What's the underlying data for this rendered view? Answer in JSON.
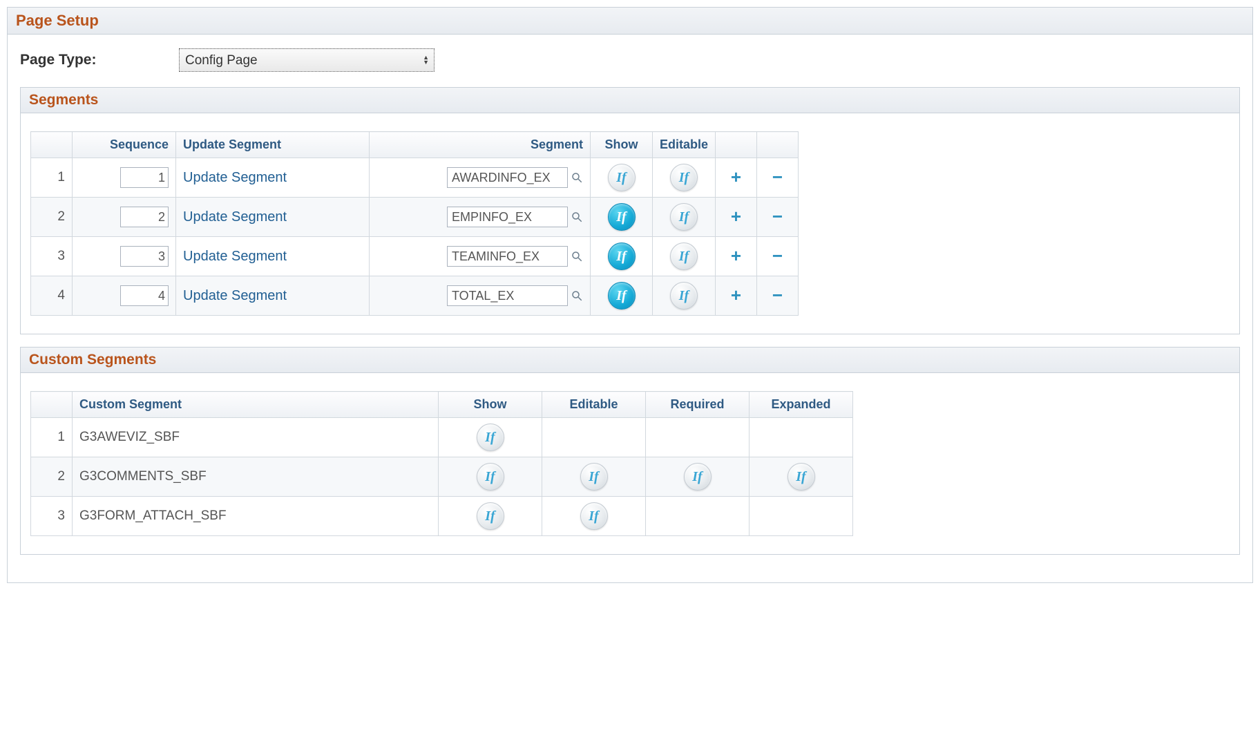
{
  "pageSetup": {
    "title": "Page Setup",
    "pageTypeLabel": "Page Type:",
    "pageTypeValue": "Config Page"
  },
  "segmentsPanel": {
    "title": "Segments",
    "headers": {
      "sequence": "Sequence",
      "updateSegment": "Update Segment",
      "segment": "Segment",
      "show": "Show",
      "editable": "Editable"
    },
    "updateLinkText": "Update Segment",
    "ifLabel": "If",
    "rows": [
      {
        "rownum": "1",
        "sequence": "1",
        "segment": "AWARDINFO_EX",
        "showActive": false,
        "editableActive": false
      },
      {
        "rownum": "2",
        "sequence": "2",
        "segment": "EMPINFO_EX",
        "showActive": true,
        "editableActive": false
      },
      {
        "rownum": "3",
        "sequence": "3",
        "segment": "TEAMINFO_EX",
        "showActive": true,
        "editableActive": false
      },
      {
        "rownum": "4",
        "sequence": "4",
        "segment": "TOTAL_EX",
        "showActive": true,
        "editableActive": false
      }
    ]
  },
  "customSegmentsPanel": {
    "title": "Custom Segments",
    "headers": {
      "customSegment": "Custom Segment",
      "show": "Show",
      "editable": "Editable",
      "required": "Required",
      "expanded": "Expanded"
    },
    "ifLabel": "If",
    "rows": [
      {
        "rownum": "1",
        "name": "G3AWEVIZ_SBF",
        "show": true,
        "editable": false,
        "required": false,
        "expanded": false
      },
      {
        "rownum": "2",
        "name": "G3COMMENTS_SBF",
        "show": true,
        "editable": true,
        "required": true,
        "expanded": true
      },
      {
        "rownum": "3",
        "name": "G3FORM_ATTACH_SBF",
        "show": true,
        "editable": true,
        "required": false,
        "expanded": false
      }
    ]
  }
}
